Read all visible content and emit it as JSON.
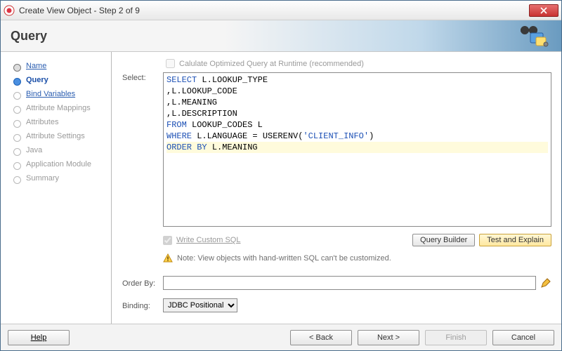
{
  "window": {
    "title": "Create View Object - Step 2 of 9"
  },
  "banner": {
    "title": "Query"
  },
  "steps": {
    "items": [
      {
        "label": "Name"
      },
      {
        "label": "Query"
      },
      {
        "label": "Bind Variables"
      },
      {
        "label": "Attribute Mappings"
      },
      {
        "label": "Attributes"
      },
      {
        "label": "Attribute Settings"
      },
      {
        "label": "Java"
      },
      {
        "label": "Application Module"
      },
      {
        "label": "Summary"
      }
    ]
  },
  "query": {
    "optimize_label": "Calulate Optimized Query at Runtime (recommended)",
    "select_label": "Select:",
    "sql": {
      "l1a": "SELECT",
      "l1b": " L.LOOKUP_TYPE",
      "l2": "  ,L.LOOKUP_CODE",
      "l3": "  ,L.MEANING",
      "l4": "  ,L.DESCRIPTION",
      "l5a": "FROM",
      "l5b": " LOOKUP_CODES L",
      "l6a": "WHERE",
      "l6b": " L.LANGUAGE = USERENV(",
      "l6c": "'CLIENT_INFO'",
      "l6d": ")",
      "l7a": "ORDER",
      "l7b": " ",
      "l7c": "BY",
      "l7d": " L.MEANING"
    },
    "write_custom_label": "Write Custom SQL",
    "query_builder_label": "Query Builder",
    "test_explain_label": "Test and Explain",
    "note_text": "Note: View objects with hand-written SQL can't be customized.",
    "orderby_label": "Order By:",
    "orderby_value": "",
    "binding_label": "Binding:",
    "binding_value": "JDBC Positional"
  },
  "footer": {
    "help": "Help",
    "back": "< Back",
    "next": "Next >",
    "finish": "Finish",
    "cancel": "Cancel"
  }
}
